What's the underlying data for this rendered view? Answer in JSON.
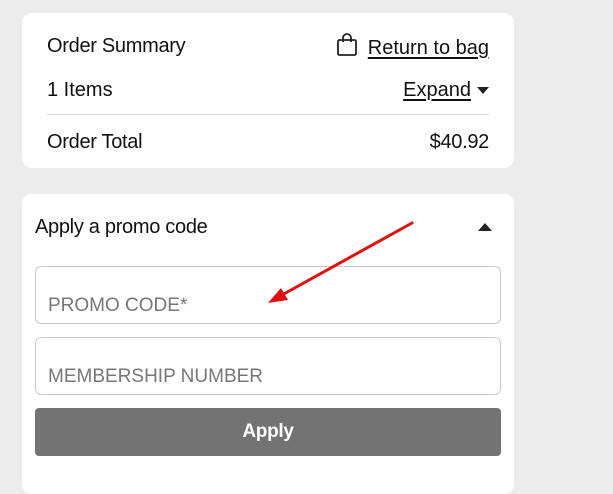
{
  "summary": {
    "title": "Order Summary",
    "return_label": "Return to bag",
    "return_icon": "shopping-bag-icon",
    "items_count": "1 Items",
    "expand_label": "Expand",
    "total_label": "Order Total",
    "total_value": "$40.92"
  },
  "promo": {
    "title": "Apply a promo code",
    "promo_placeholder": "PROMO CODE*",
    "membership_placeholder": "MEMBERSHIP NUMBER",
    "apply_label": "Apply"
  },
  "colors": {
    "background": "#ececec",
    "card": "#ffffff",
    "button": "#737373",
    "annotation_arrow": "#e01010"
  }
}
